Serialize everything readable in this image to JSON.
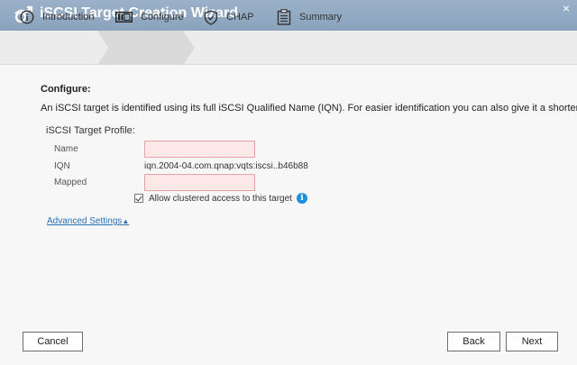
{
  "window": {
    "title": "iSCSI Target Creation Wizard",
    "close_glyph": "×"
  },
  "steps": [
    {
      "label": "Introduction",
      "icon": "info-circle-icon",
      "active": false
    },
    {
      "label": "Configure",
      "icon": "target-config-icon",
      "active": true
    },
    {
      "label": "CHAP",
      "icon": "shield-check-icon",
      "active": false
    },
    {
      "label": "Summary",
      "icon": "clipboard-list-icon",
      "active": false
    }
  ],
  "configure": {
    "section_title": "Configure:",
    "description": "An iSCSI target is identified using its full iSCSI Qualified Name (IQN). For easier identification you can also give it a shorter alias.",
    "profile_label": "iSCSI Target Profile:",
    "name_label": "Name",
    "name_value": "",
    "iqn_label": "IQN",
    "iqn_value": "iqn.2004-04.com.qnap:vqts:iscsi..b46b88",
    "mapped_label": "Mapped",
    "mapped_value": "",
    "clustered_checkbox_label": "Allow clustered access to this target",
    "clustered_checked": true,
    "info_glyph": "i"
  },
  "advanced": {
    "link_label": "Advanced Settings",
    "arrow_glyph": "▲"
  },
  "footer": {
    "cancel_label": "Cancel",
    "back_label": "Back",
    "next_label": "Next"
  },
  "colors": {
    "titlebar": "#8aa3bc",
    "required_field_bg": "#fde8e8",
    "required_field_border": "#e5a3a3",
    "link": "#2a6fb5",
    "info_icon": "#1c8fe0"
  }
}
